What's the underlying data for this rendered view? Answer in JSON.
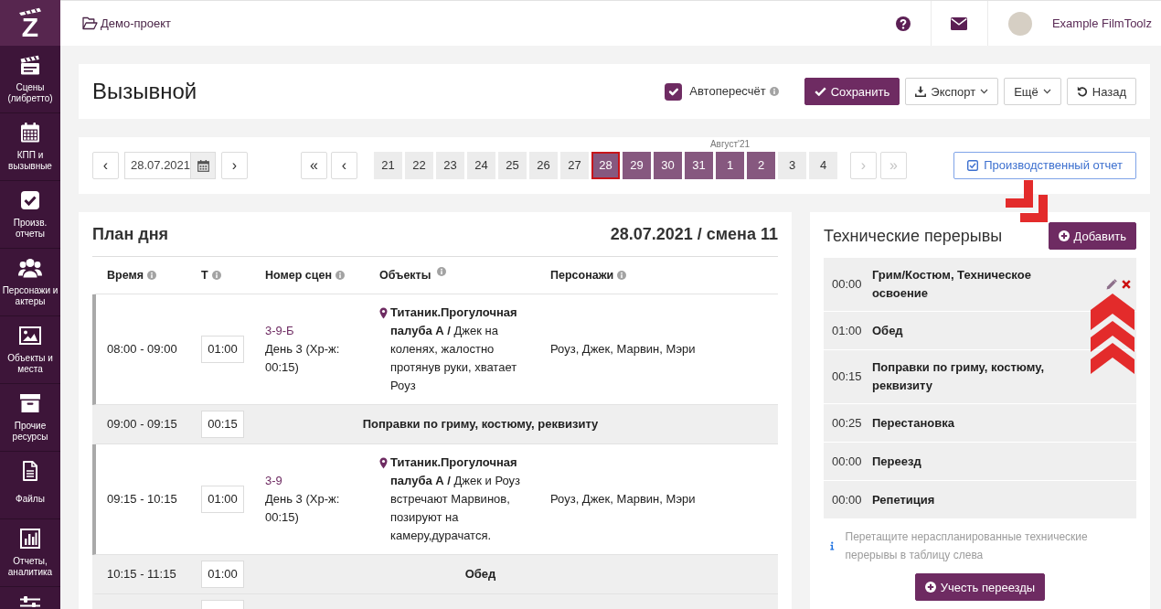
{
  "sidebar": {
    "logo": "Z",
    "items": [
      {
        "label": "Сцены (либретто)"
      },
      {
        "label": "КПП и вызывные"
      },
      {
        "label": "Произв. отчеты"
      },
      {
        "label": "Персонажи и актеры"
      },
      {
        "label": "Объекты и места"
      },
      {
        "label": "Прочие ресурсы"
      },
      {
        "label": "Файлы"
      },
      {
        "label": "Отчеты, аналитика"
      }
    ]
  },
  "top_bar": {
    "project": "Демо-проект",
    "user_name": "Example FilmToolz"
  },
  "page_header": {
    "title": "Вызывной",
    "autorecalc": {
      "label": "Автопересчёт",
      "checked": true
    },
    "actions": [
      {
        "label": "Сохранить",
        "kind": "primary"
      },
      {
        "label": "Экспорт",
        "kind": "dropdown"
      },
      {
        "label": "Ещё",
        "kind": "dropdown"
      },
      {
        "label": "Назад",
        "kind": "plain"
      }
    ]
  },
  "date_nav": {
    "prev": "‹",
    "date": "28.07.2021",
    "next": "›"
  },
  "day_strip": {
    "before": [
      {
        "label": "«",
        "disabled": false
      },
      {
        "label": "‹",
        "disabled": false
      }
    ],
    "days": [
      {
        "label": "21",
        "shooting": false,
        "selected": false
      },
      {
        "label": "22",
        "shooting": false,
        "selected": false
      },
      {
        "label": "23",
        "shooting": false,
        "selected": false
      },
      {
        "label": "24",
        "shooting": false,
        "selected": false
      },
      {
        "label": "25",
        "shooting": false,
        "selected": false
      },
      {
        "label": "26",
        "shooting": false,
        "selected": false
      },
      {
        "label": "27",
        "shooting": false,
        "selected": false
      },
      {
        "label": "28",
        "shooting": true,
        "selected": true
      },
      {
        "label": "29",
        "shooting": true,
        "selected": false
      },
      {
        "label": "30",
        "shooting": true,
        "selected": false
      },
      {
        "label": "31",
        "shooting": true,
        "selected": false
      },
      {
        "label": "1",
        "shooting": true,
        "selected": false,
        "month": "Август'21"
      },
      {
        "label": "2",
        "shooting": true,
        "selected": false
      },
      {
        "label": "3",
        "shooting": false,
        "selected": false
      },
      {
        "label": "4",
        "shooting": false,
        "selected": false
      }
    ],
    "after": [
      {
        "label": "›",
        "disabled": true
      },
      {
        "label": "»",
        "disabled": true
      }
    ]
  },
  "report_button": "Производственный отчет",
  "plan": {
    "title": "План дня",
    "subtitle": "28.07.2021 / смена 11",
    "columns": [
      "Время",
      "Т",
      "Номер сцен",
      "Объекты",
      "Персонажи"
    ],
    "rows": [
      {
        "kind": "scene",
        "time": "08:00 - 09:00",
        "duration": "01:00",
        "scene": "3-9-Б",
        "scene_info": "День 3 (Хр-ж: 00:15)",
        "objects": "**Титаник.Прогулочная палуба А /** Джек на коленях, жалостно протянув руки, хватает Роуз",
        "characters": "Роуз, Джек, Марвин, Мэри"
      },
      {
        "kind": "break",
        "time": "09:00 - 09:15",
        "duration": "00:15",
        "title": "Поправки по гриму, костюму, реквизиту"
      },
      {
        "kind": "scene",
        "time": "09:15 - 10:15",
        "duration": "01:00",
        "scene": "3-9",
        "scene_info": "День 3 (Хр-ж: 00:15)",
        "objects": "**Титаник.Прогулочная палуба А /** Джек и Роуз встречают Марвинов, позируют на камеру,дурачатся.",
        "characters": "Роуз, Джек, Марвин, Мэри"
      },
      {
        "kind": "break",
        "time": "10:15 - 11:15",
        "duration": "01:00",
        "title": "Обед"
      },
      {
        "kind": "break"
      }
    ]
  },
  "breaks": {
    "title": "Технические перерывы",
    "add_label": "Добавить",
    "items": [
      {
        "duration": "00:00",
        "title": "Грим/Костюм, Техническое освоение",
        "actions_shown": true
      },
      {
        "duration": "01:00",
        "title": "Обед",
        "actions_shown": false
      },
      {
        "duration": "00:15",
        "title": "Поправки по гриму, костюму, реквизиту",
        "actions_shown": false
      },
      {
        "duration": "00:25",
        "title": "Перестановка",
        "actions_shown": false
      },
      {
        "duration": "00:00",
        "title": "Переезд",
        "actions_shown": false
      },
      {
        "duration": "00:00",
        "title": "Репетиция",
        "actions_shown": false
      }
    ],
    "hint": "Перетащите нераспланированные технические перерывы в таблицу слева",
    "bottom_button": "Учесть переезды"
  }
}
